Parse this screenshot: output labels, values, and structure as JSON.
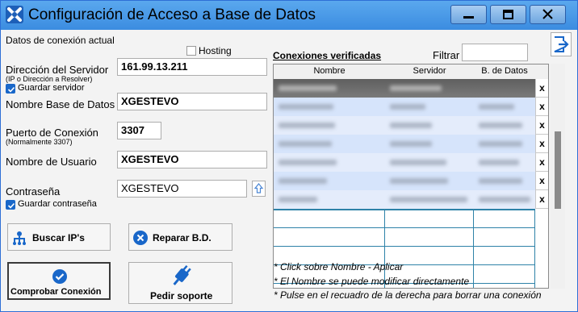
{
  "window": {
    "title": "Configuración de Acceso a Base de Datos"
  },
  "form": {
    "section_title": "Datos de conexión actual",
    "hosting_label": "Hosting",
    "hosting_checked": false,
    "server_label": "Dirección del Servidor",
    "server_hint": "(IP o Dirección a Resolver)",
    "server_value": "161.99.13.211",
    "save_server_label": "Guardar servidor",
    "save_server_checked": true,
    "dbname_label": "Nombre Base de Datos",
    "dbname_value": "XGESTEVO",
    "port_label": "Puerto de Conexión",
    "port_hint": "(Normalmente 3307)",
    "port_value": "3307",
    "user_label": "Nombre de Usuario",
    "user_value": "XGESTEVO",
    "password_label": "Contraseña",
    "password_value": "XGESTEVO",
    "save_password_label": "Guardar contraseña",
    "save_password_checked": true
  },
  "buttons": {
    "search_ips": "Buscar IP's",
    "repair_db": "Reparar B.D.",
    "check_connection": "Comprobar Conexión",
    "request_support": "Pedir soporte"
  },
  "connections": {
    "title": "Conexiones verificadas",
    "filter_label": "Filtrar",
    "filter_value": "",
    "columns": [
      "Nombre",
      "Servidor",
      "B. de Datos"
    ],
    "rows": [
      {
        "delete": "x"
      },
      {
        "delete": "x"
      },
      {
        "delete": "x"
      },
      {
        "delete": "x"
      },
      {
        "delete": "x"
      },
      {
        "delete": "x"
      },
      {
        "delete": "x"
      }
    ],
    "notes": [
      "* Click sobre Nombre - Aplicar",
      "* El Nombre se puede modificar directamente",
      "* Pulse en el recuadro de la derecha para borrar una conexión"
    ]
  },
  "colors": {
    "accent": "#1967c9",
    "titlebar": "#4a9ae8",
    "grid_selected": "#d6e4fb"
  }
}
